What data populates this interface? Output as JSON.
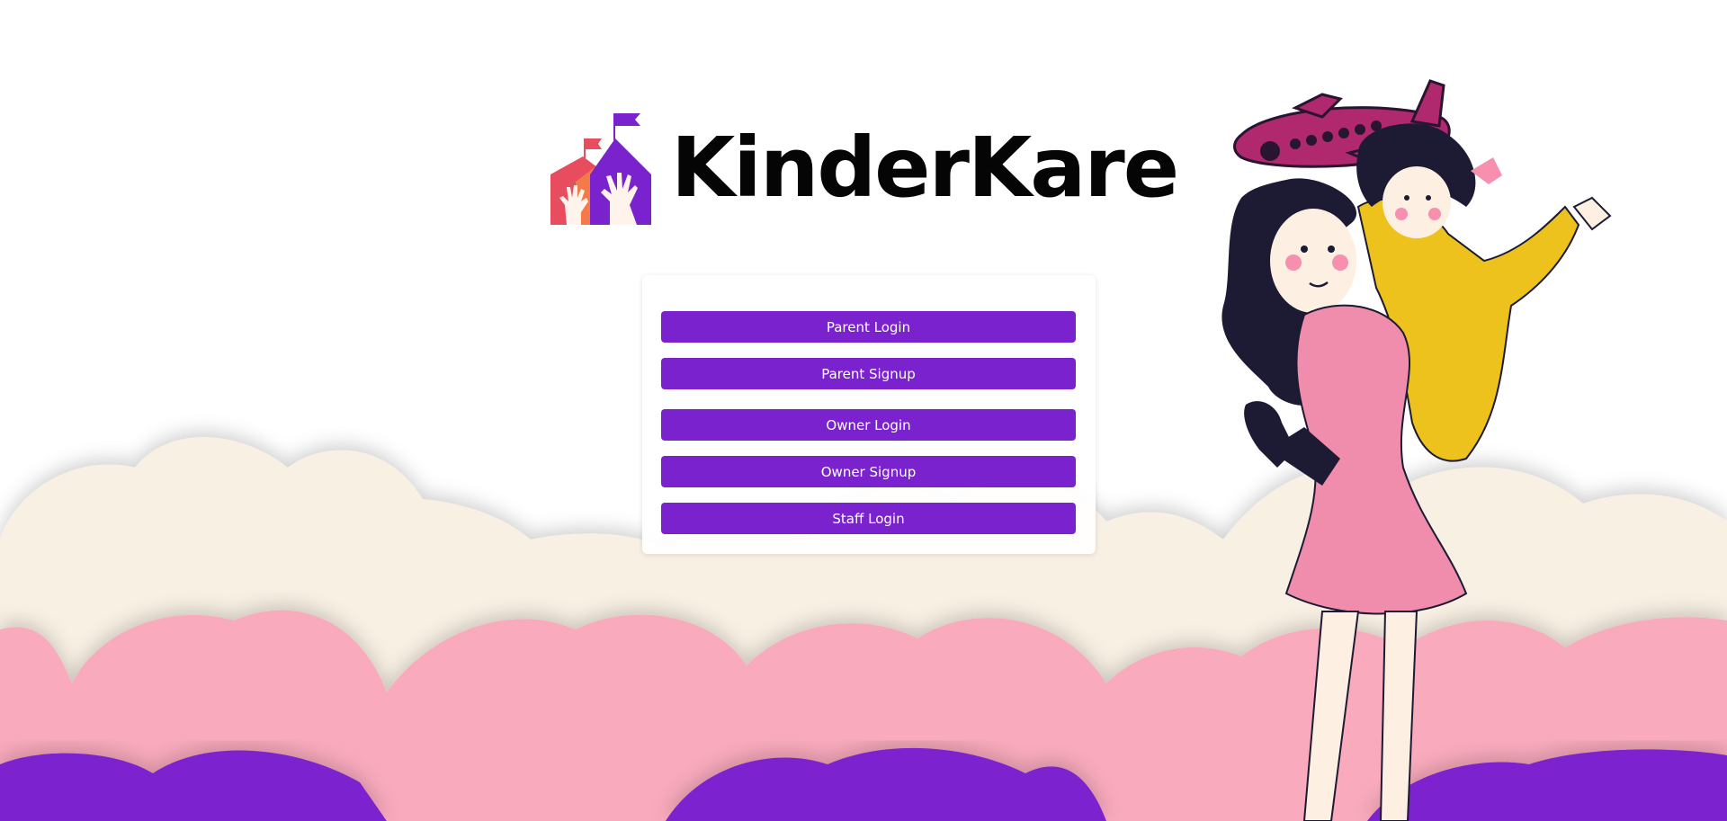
{
  "brand": {
    "name": "KinderKare",
    "colors": {
      "purple": "#7b22cf",
      "pink": "#f9aabd",
      "cream": "#f8f0e3",
      "text": "#050505"
    }
  },
  "auth": {
    "buttons": [
      {
        "label": "Parent Login"
      },
      {
        "label": "Parent Signup"
      },
      {
        "label": "Owner Login"
      },
      {
        "label": "Owner Signup"
      },
      {
        "label": "Staff Login"
      }
    ]
  },
  "decor": {
    "logo_icon": "schoolhouse-hands-icon",
    "illustration": "girl-carrying-child-with-toy-airplane"
  }
}
